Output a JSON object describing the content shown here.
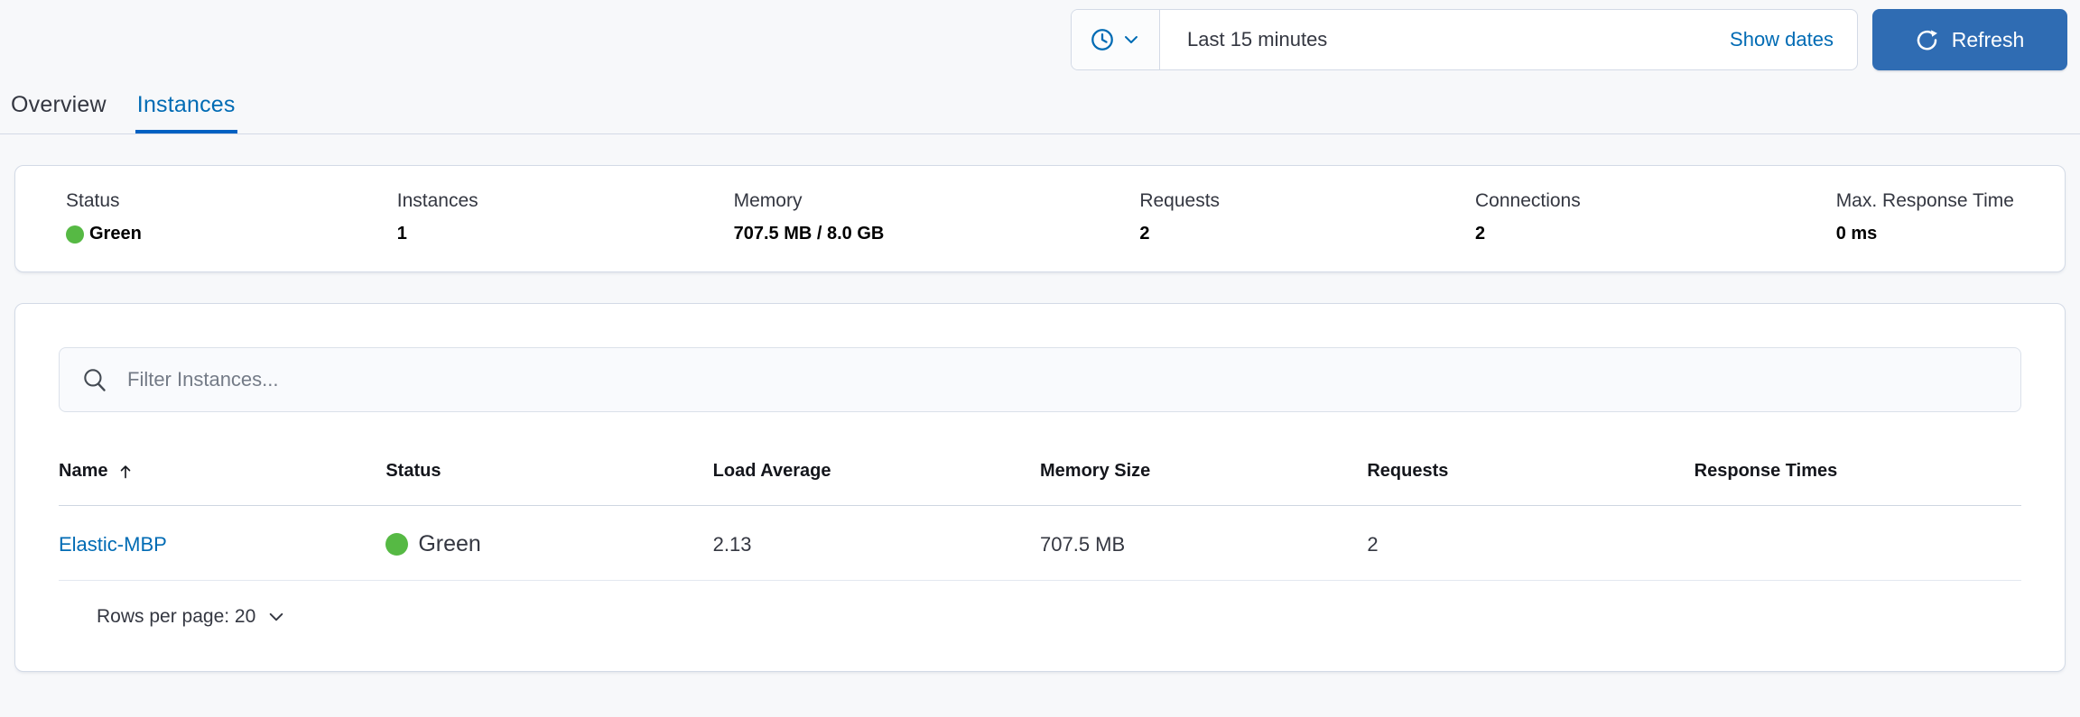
{
  "colors": {
    "accent_blue": "#006bb4",
    "tab_underline": "#0061c2",
    "refresh_button_blue": "#2f6cb3",
    "status_green": "#56b944",
    "text_dark": "#343741",
    "panel_border": "#d3dae6",
    "page_background": "#f7f8fa"
  },
  "time_controls": {
    "quick_select_icon": "clock-icon",
    "selected_range": "Last 15 minutes",
    "show_dates_label": "Show dates",
    "refresh_label": "Refresh"
  },
  "tabs": [
    {
      "label": "Overview",
      "active": false
    },
    {
      "label": "Instances",
      "active": true
    }
  ],
  "summary": {
    "stats": [
      {
        "label": "Status",
        "value": "Green",
        "has_status_dot": true
      },
      {
        "label": "Instances",
        "value": "1"
      },
      {
        "label": "Memory",
        "value": "707.5 MB / 8.0 GB"
      },
      {
        "label": "Requests",
        "value": "2"
      },
      {
        "label": "Connections",
        "value": "2"
      },
      {
        "label": "Max. Response Time",
        "value": "0 ms"
      }
    ]
  },
  "instances_panel": {
    "filter_placeholder": "Filter Instances...",
    "table": {
      "columns": [
        {
          "label": "Name",
          "sorted": "ascending"
        },
        {
          "label": "Status"
        },
        {
          "label": "Load Average"
        },
        {
          "label": "Memory Size"
        },
        {
          "label": "Requests"
        },
        {
          "label": "Response Times"
        }
      ],
      "rows": [
        {
          "name": "Elastic-MBP",
          "status": "Green",
          "load_average": "2.13",
          "memory_size": "707.5 MB",
          "requests": "2",
          "response_times": ""
        }
      ]
    },
    "pagination": {
      "rows_per_page_label": "Rows per page: 20"
    }
  }
}
